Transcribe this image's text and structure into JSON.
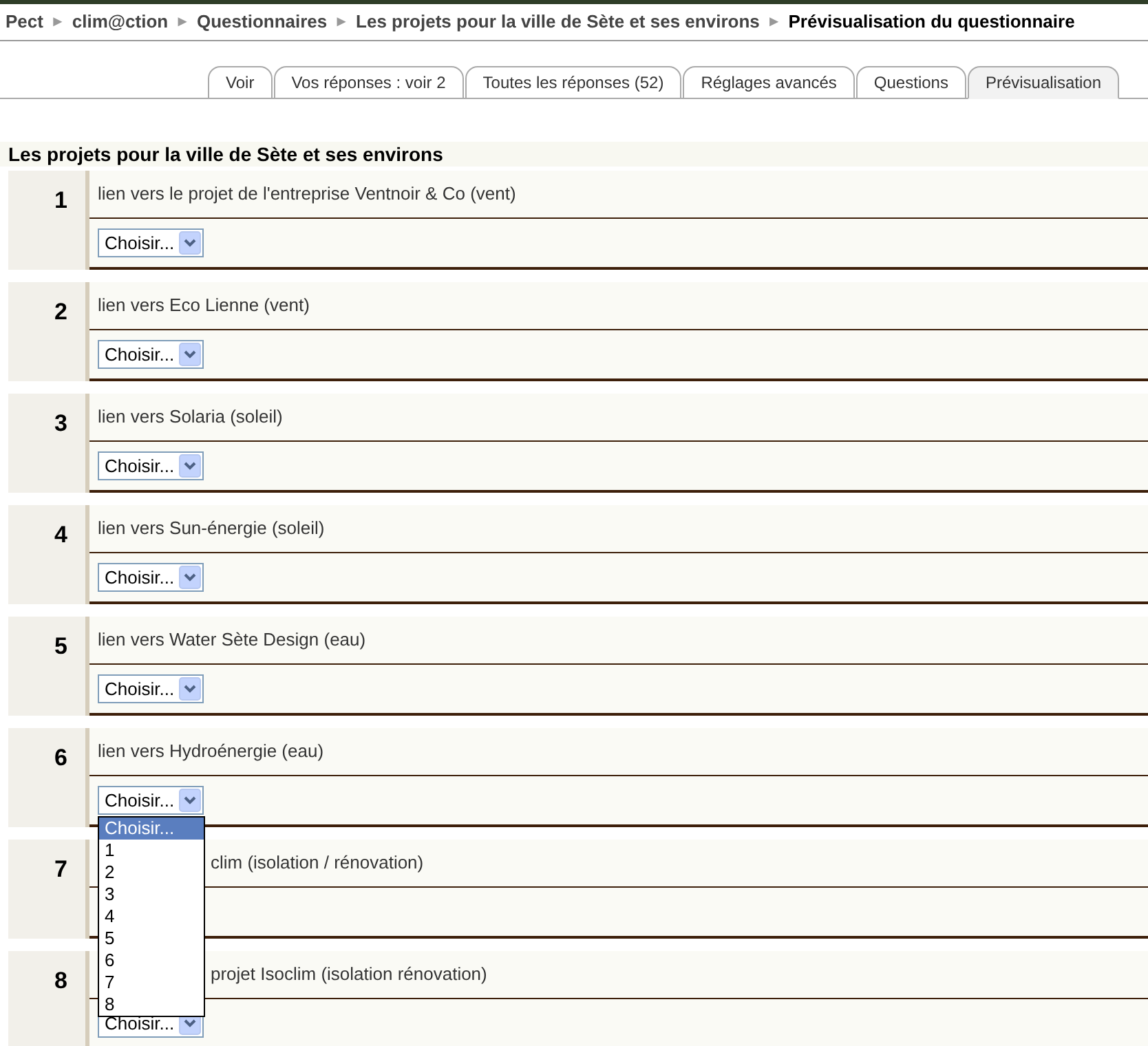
{
  "breadcrumb": [
    {
      "label": "Pect",
      "current": false
    },
    {
      "label": "clim@ction",
      "current": false
    },
    {
      "label": "Questionnaires",
      "current": false
    },
    {
      "label": "Les projets pour la ville de Sète et ses environs",
      "current": false
    },
    {
      "label": "Prévisualisation du questionnaire",
      "current": true
    }
  ],
  "breadcrumb_separator": "►",
  "tabs": [
    {
      "label": "Voir",
      "selected": false
    },
    {
      "label": "Vos réponses : voir 2",
      "selected": false
    },
    {
      "label": "Toutes les réponses (52)",
      "selected": false
    },
    {
      "label": "Réglages avancés",
      "selected": false
    },
    {
      "label": "Questions",
      "selected": false
    },
    {
      "label": "Prévisualisation",
      "selected": true
    }
  ],
  "heading": "Les projets pour la ville de Sète et ses environs",
  "questions": [
    {
      "number": "1",
      "kind": "plain",
      "text": "lien vers le projet de l'entreprise Ventnoir & Co (vent)",
      "select": "Choisir..."
    },
    {
      "number": "2",
      "kind": "plain",
      "text": "lien vers Eco Lienne (vent)",
      "select": "Choisir..."
    },
    {
      "number": "3",
      "kind": "plain",
      "text": "lien vers Solaria (soleil)",
      "select": "Choisir..."
    },
    {
      "number": "4",
      "kind": "plain",
      "text": "lien vers Sun-énergie (soleil)",
      "select": "Choisir..."
    },
    {
      "number": "5",
      "kind": "plain",
      "text": "lien vers Water Sète Design (eau)",
      "select": "Choisir..."
    },
    {
      "number": "6",
      "kind": "plain",
      "text": "lien vers Hydroénergie (eau)",
      "select": "Choisir...",
      "dropdown": [
        {
          "label": "Choisir...",
          "selected": true
        },
        {
          "label": "1",
          "selected": false
        },
        {
          "label": "2",
          "selected": false
        },
        {
          "label": "3",
          "selected": false
        },
        {
          "label": "4",
          "selected": false
        },
        {
          "label": "5",
          "selected": false
        },
        {
          "label": "6",
          "selected": false
        },
        {
          "label": "7",
          "selected": false
        },
        {
          "label": "8",
          "selected": false
        }
      ]
    },
    {
      "number": "7",
      "kind": "covered",
      "text": "clim (isolation / rénovation)"
    },
    {
      "number": "8",
      "kind": "covered",
      "text": "projet Isoclim (isolation rénovation)",
      "select": "Choisir..."
    }
  ]
}
